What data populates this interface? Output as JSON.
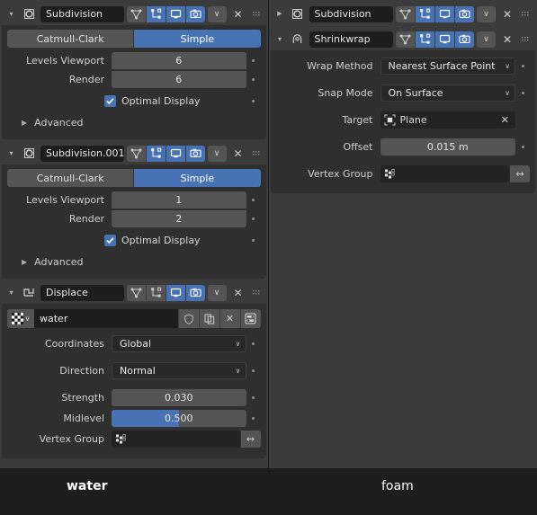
{
  "theme": {
    "accent_blue": "#4772b3",
    "panel_bg": "#2f2f2f",
    "header_bg": "#3b3b3b",
    "widget_bg": "#545454",
    "text": "#e5e5e5",
    "window_bg": "#1d1d1d"
  },
  "left_column": {
    "modifiers": [
      {
        "name": "Subdivision",
        "type_icon": "subdivision-icon",
        "expanded": true,
        "expand_glyph": "▾",
        "display_toggles": [
          {
            "name": "on-cage",
            "icon": "vertex-triangle-icon",
            "on": false
          },
          {
            "name": "edit-mode",
            "icon": "edit-mode-icon",
            "on": true
          },
          {
            "name": "realtime",
            "icon": "monitor-icon",
            "on": true
          },
          {
            "name": "render",
            "icon": "camera-icon",
            "on": true
          }
        ],
        "extras_glyph": "∨",
        "close_glyph": "✕",
        "subdivision_type": {
          "options": [
            "Catmull-Clark",
            "Simple"
          ],
          "selected": "Simple"
        },
        "fields": [
          {
            "label": "Levels Viewport",
            "value": "6"
          },
          {
            "label": "Render",
            "value": "6"
          }
        ],
        "optimal_display": {
          "label": "Optimal Display",
          "checked": true
        },
        "advanced": {
          "label": "Advanced",
          "expanded": false,
          "glyph": "▶"
        }
      },
      {
        "name": "Subdivision.001",
        "type_icon": "subdivision-icon",
        "expanded": true,
        "expand_glyph": "▾",
        "display_toggles": [
          {
            "name": "on-cage",
            "icon": "vertex-triangle-icon",
            "on": false
          },
          {
            "name": "edit-mode",
            "icon": "edit-mode-icon",
            "on": true
          },
          {
            "name": "realtime",
            "icon": "monitor-icon",
            "on": true
          },
          {
            "name": "render",
            "icon": "camera-icon",
            "on": true
          }
        ],
        "extras_glyph": "∨",
        "close_glyph": "✕",
        "subdivision_type": {
          "options": [
            "Catmull-Clark",
            "Simple"
          ],
          "selected": "Simple"
        },
        "fields": [
          {
            "label": "Levels Viewport",
            "value": "1"
          },
          {
            "label": "Render",
            "value": "2"
          }
        ],
        "optimal_display": {
          "label": "Optimal Display",
          "checked": true
        },
        "advanced": {
          "label": "Advanced",
          "expanded": false,
          "glyph": "▶"
        }
      },
      {
        "name": "Displace",
        "type_icon": "displace-icon",
        "expanded": true,
        "expand_glyph": "▾",
        "display_toggles": [
          {
            "name": "on-cage",
            "icon": "vertex-triangle-icon",
            "on": false
          },
          {
            "name": "edit-mode",
            "icon": "edit-mode-icon",
            "on": false
          },
          {
            "name": "realtime",
            "icon": "monitor-icon",
            "on": true
          },
          {
            "name": "render",
            "icon": "camera-icon",
            "on": true
          }
        ],
        "extras_glyph": "∨",
        "close_glyph": "✕",
        "texture": {
          "browse_icon": "checker-texture-icon",
          "browse_chevron": "∨",
          "name": "water",
          "fake_user_icon": "shield-icon",
          "duplicate_icon": "copy-icon",
          "unlink_glyph": "✕",
          "properties_icon": "texture-properties-icon"
        },
        "coordinates": {
          "label": "Coordinates",
          "value": "Global",
          "chevron": "∨"
        },
        "direction": {
          "label": "Direction",
          "value": "Normal",
          "chevron": "∨"
        },
        "strength": {
          "label": "Strength",
          "value": "0.030",
          "fill_percent": 0
        },
        "midlevel": {
          "label": "Midlevel",
          "value": "0.500",
          "fill_percent": 50
        },
        "vertex_group": {
          "label": "Vertex Group",
          "value": "",
          "icon": "vertex-group-icon",
          "invert_glyph": "↔"
        }
      }
    ]
  },
  "right_column": {
    "modifiers": [
      {
        "name": "Subdivision",
        "type_icon": "subdivision-icon",
        "expanded": false,
        "expand_glyph": "▶",
        "display_toggles": [
          {
            "name": "on-cage",
            "icon": "vertex-triangle-icon",
            "on": false
          },
          {
            "name": "edit-mode",
            "icon": "edit-mode-icon",
            "on": true
          },
          {
            "name": "realtime",
            "icon": "monitor-icon",
            "on": true
          },
          {
            "name": "render",
            "icon": "camera-icon",
            "on": true
          }
        ],
        "extras_glyph": "∨",
        "close_glyph": "✕"
      },
      {
        "name": "Shrinkwrap",
        "type_icon": "shrinkwrap-icon",
        "expanded": true,
        "expand_glyph": "▾",
        "display_toggles": [
          {
            "name": "on-cage",
            "icon": "vertex-triangle-icon",
            "on": false
          },
          {
            "name": "edit-mode",
            "icon": "edit-mode-icon",
            "on": true
          },
          {
            "name": "realtime",
            "icon": "monitor-icon",
            "on": true
          },
          {
            "name": "render",
            "icon": "camera-icon",
            "on": true
          }
        ],
        "extras_glyph": "∨",
        "close_glyph": "✕",
        "wrap_method": {
          "label": "Wrap Method",
          "value": "Nearest Surface Point",
          "chevron": "∨"
        },
        "snap_mode": {
          "label": "Snap Mode",
          "value": "On Surface",
          "chevron": "∨"
        },
        "target": {
          "label": "Target",
          "value": "Plane",
          "icon": "mesh-object-icon",
          "clear_glyph": "✕"
        },
        "offset": {
          "label": "Offset",
          "value": "0.015 m"
        },
        "vertex_group": {
          "label": "Vertex Group",
          "value": "",
          "icon": "vertex-group-icon",
          "invert_glyph": "↔"
        }
      }
    ]
  },
  "captions": {
    "left": "water",
    "right": "foam"
  }
}
